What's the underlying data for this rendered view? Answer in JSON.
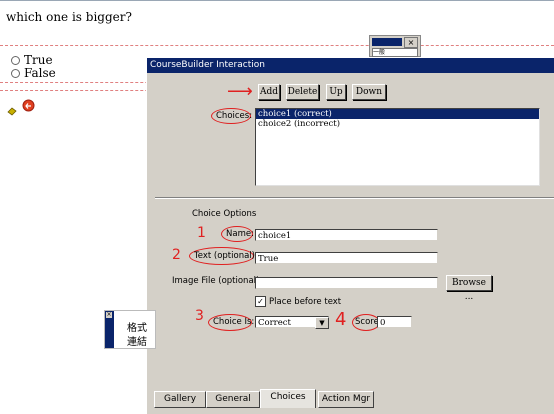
{
  "page": {
    "question": "which one is bigger?",
    "options": [
      "True",
      "False"
    ]
  },
  "mini_window": {
    "close_glyph": "×",
    "select_value": "一般"
  },
  "dialog": {
    "title": "CourseBuilder Interaction",
    "buttons": {
      "add": "Add",
      "delete": "Delete",
      "up": "Up",
      "down": "Down"
    },
    "choices_label": "Choices:",
    "choices": [
      {
        "label": "choice1 (correct)",
        "selected": true
      },
      {
        "label": "choice2 (incorrect)",
        "selected": false
      }
    ],
    "choice_options_title": "Choice Options",
    "name_label": "Name:",
    "name_value": "choice1",
    "text_label": "Text (optional):",
    "text_value": "True",
    "image_label": "Image File (optional):",
    "image_value": "",
    "browse_label": "Browse ...",
    "place_before_text_label": "Place before text",
    "place_before_text_checked": true,
    "choice_is_label": "Choice Is:",
    "choice_is_value": "Correct",
    "score_label": "Score:",
    "score_value": "0",
    "tabs": [
      "Gallery",
      "General",
      "Choices",
      "Action Mgr"
    ],
    "active_tab": "Choices"
  },
  "annotations": {
    "arrow": "⟶",
    "n1": "1",
    "n2": "2",
    "n3": "3",
    "n4": "4"
  },
  "tooltip": {
    "line1": "格式",
    "line2": "連結"
  },
  "colors": {
    "annotation": "#e02020",
    "titlebar": "#0a246a",
    "dialog_bg": "#d4d0c8"
  }
}
